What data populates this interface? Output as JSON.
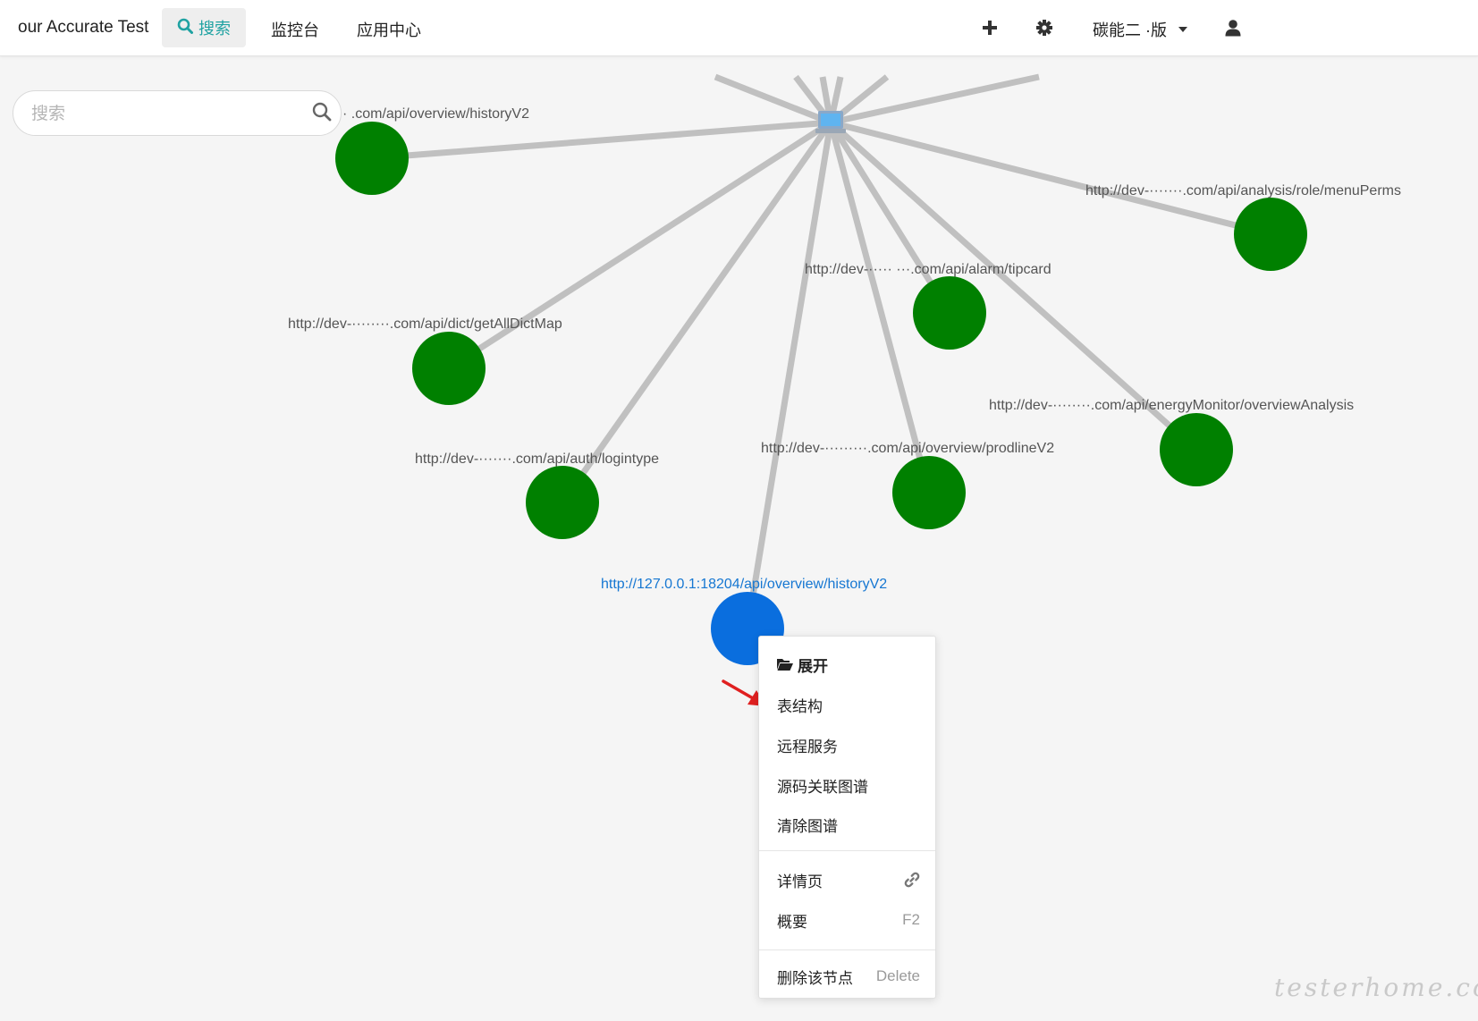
{
  "header": {
    "brand": "our Accurate Test",
    "nav": {
      "search_label": "搜索",
      "monitor_label": "监控台",
      "app_center_label": "应用中心"
    },
    "user_name": "碳能二  ·版"
  },
  "search": {
    "placeholder": "搜索",
    "value": ""
  },
  "graph": {
    "edge_color": "#c0c0c0",
    "node_color": "#008000",
    "selected_node_color": "#0a6ede",
    "center_icon": "computer-icon",
    "nodes": [
      {
        "id": "historyV2",
        "label": "· .com/api/overview/historyV2"
      },
      {
        "id": "menuPerms",
        "label": "http://dev-·······.com/api/analysis/role/menuPerms"
      },
      {
        "id": "tipcard",
        "label": "http://dev-····· ···.com/api/alarm/tipcard"
      },
      {
        "id": "getAllDictMap",
        "label": "http://dev-········.com/api/dict/getAllDictMap"
      },
      {
        "id": "overviewAnalysis",
        "label": "http://dev-········.com/api/energyMonitor/overviewAnalysis"
      },
      {
        "id": "prodlineV2",
        "label": "http://dev-·········.com/api/overview/prodlineV2"
      },
      {
        "id": "logintype",
        "label": "http://dev-·······.com/api/auth/logintype"
      },
      {
        "id": "selected",
        "label": "http://127.0.0.1:18204/api/overview/historyV2",
        "selected": true
      }
    ]
  },
  "context_menu": {
    "expand": "展开",
    "table_structure": "表结构",
    "remote_service": "远程服务",
    "source_graph": "源码关联图谱",
    "clear_graph": "清除图谱",
    "details": "详情页",
    "summary": "概要",
    "summary_shortcut": "F2",
    "delete_node": "删除该节点",
    "delete_shortcut": "Delete"
  },
  "watermark": "testerhome.com"
}
